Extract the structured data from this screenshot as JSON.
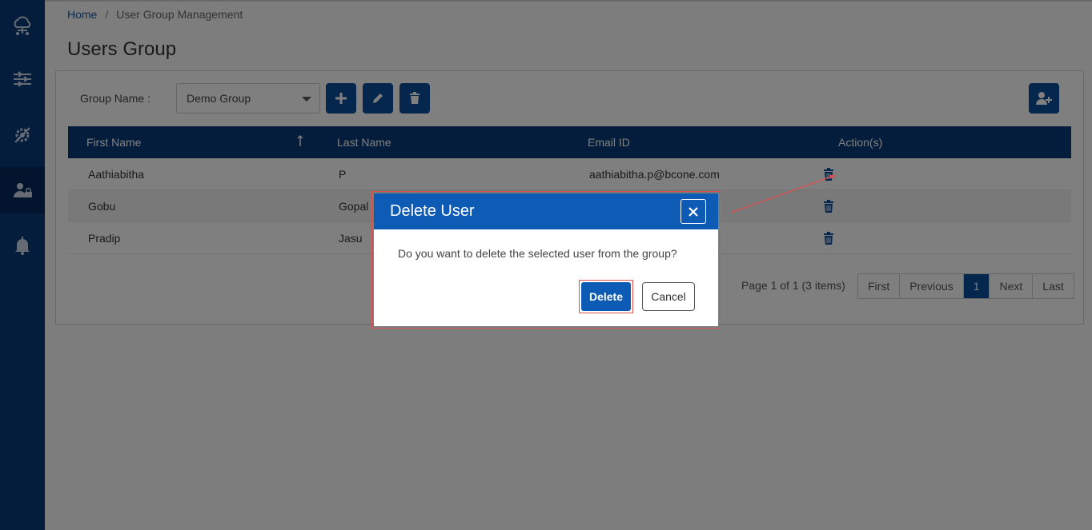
{
  "sidebar": {
    "items": [
      {
        "icon": "cloud-network-icon"
      },
      {
        "icon": "flow-sliders-icon"
      },
      {
        "icon": "settings-gear-icon"
      },
      {
        "icon": "user-lock-icon",
        "active": true
      },
      {
        "icon": "bell-icon"
      }
    ]
  },
  "breadcrumb": {
    "home": "Home",
    "separator": "/",
    "current": "User Group Management"
  },
  "page": {
    "title": "Users Group"
  },
  "toolbar": {
    "group_label": "Group Name :",
    "group_value": "Demo Group"
  },
  "grid": {
    "headers": [
      "First Name",
      "Last Name",
      "Email ID",
      "Action(s)"
    ],
    "rows": [
      {
        "first": "Aathiabitha",
        "last": "P",
        "email": "aathiabitha.p@bcone.com"
      },
      {
        "first": "Gobu",
        "last": "Gopal",
        "email": ""
      },
      {
        "first": "Pradip",
        "last": "Jasu",
        "email": ""
      }
    ]
  },
  "pager": {
    "info": "Page 1 of 1 (3 items)",
    "first": "First",
    "previous": "Previous",
    "current": "1",
    "next": "Next",
    "last": "Last"
  },
  "modal": {
    "title": "Delete User",
    "message": "Do you want to delete the selected user from the group?",
    "delete_label": "Delete",
    "cancel_label": "Cancel"
  },
  "colors": {
    "primary": "#0d5bb5",
    "sidebar": "#0a3a78",
    "annotation": "#e05050"
  }
}
